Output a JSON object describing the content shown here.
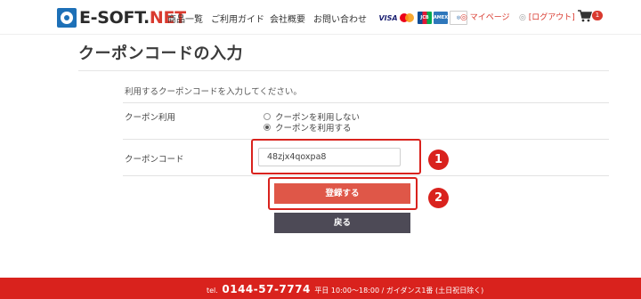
{
  "header": {
    "logo_prefix": "E-SOFT.",
    "logo_suffix": "NET",
    "nav": [
      "商品一覧",
      "ご利用ガイド",
      "会社概要",
      "お問い合わせ"
    ],
    "cards": [
      "VISA",
      "MasterCard",
      "JCB",
      "AMEX",
      "Diners Club"
    ],
    "mypage": "マイページ",
    "logout": "[ログアウト]",
    "cart_count": "1"
  },
  "page": {
    "title": "クーポンコードの入力",
    "intro": "利用するクーポンコードを入力してください。"
  },
  "coupon_usage": {
    "label": "クーポン利用",
    "options": [
      "クーポンを利用しない",
      "クーポンを利用する"
    ],
    "selected_index": 1
  },
  "coupon_code": {
    "label": "クーポンコード",
    "value": "48zjx4qoxpa8"
  },
  "buttons": {
    "register": "登録する",
    "back": "戻る"
  },
  "markers": [
    "1",
    "2"
  ],
  "colors": {
    "accent_red": "#d9221d",
    "register_button": "#df5748",
    "back_button": "#4d4a56",
    "logo_blue": "#1d70b7"
  },
  "footer": {
    "tel_label": "tel.",
    "tel_number": "0144-57-7774",
    "hours": "平日 10:00〜18:00 / ガイダンス1番 (土日祝日除く)"
  }
}
